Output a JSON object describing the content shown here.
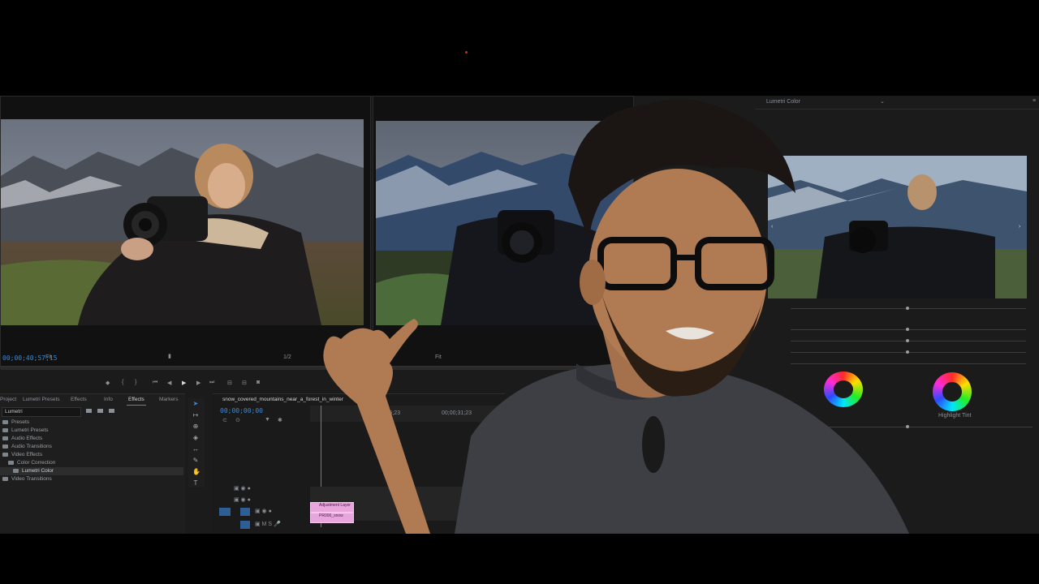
{
  "program_monitor": {
    "timecode": "00;00;40;57;15",
    "fit_label": "Fit",
    "quality_label": "1/2"
  },
  "source_monitor": {
    "fit_label": "Fit"
  },
  "effects_panel": {
    "tabs": [
      "Project",
      "Lumetri Presets",
      "Effects",
      "Info",
      "Effects",
      "Markers"
    ],
    "active_tab_index": 4,
    "search_value": "Lumetri",
    "tree": [
      {
        "label": "Presets",
        "level": 0
      },
      {
        "label": "Lumetri Presets",
        "level": 0
      },
      {
        "label": "Audio Effects",
        "level": 0
      },
      {
        "label": "Audio Transitions",
        "level": 0
      },
      {
        "label": "Video Effects",
        "level": 0
      },
      {
        "label": "Color Correction",
        "level": 1
      },
      {
        "label": "Lumetri Color",
        "level": 2,
        "selected": true
      },
      {
        "label": "Video Transitions",
        "level": 0
      }
    ]
  },
  "timeline": {
    "sequence_tab": "snow_covered_mountains_near_a_forest_in_winter",
    "timecode": "00;00;00;00",
    "ruler_labels": [
      "00;00;15;23",
      "00;00;31;23"
    ],
    "clips": [
      "Adjustment Layer",
      "PR000_snow"
    ]
  },
  "lumetri": {
    "header": "Lumetri Color",
    "wheel_labels": [
      "",
      "Highlight Tint"
    ]
  },
  "colors": {
    "accent_blue": "#3a8ad6",
    "clip_pink": "#e8a6dd",
    "panel_bg": "#1b1b1b"
  }
}
